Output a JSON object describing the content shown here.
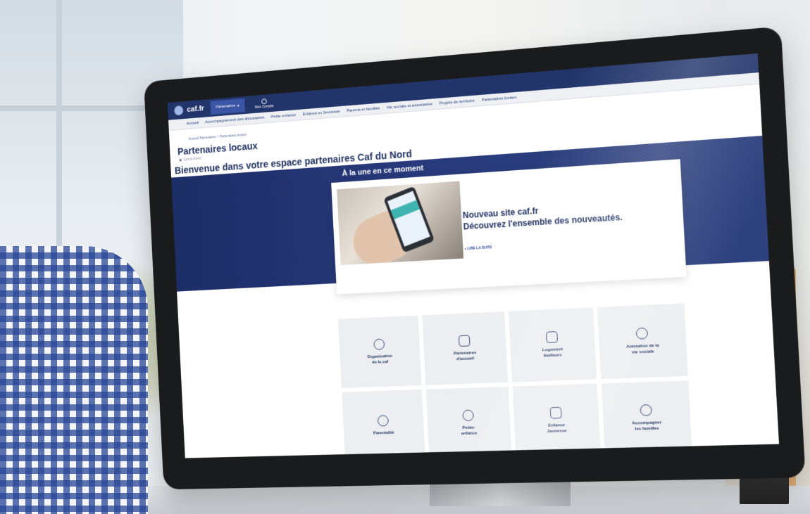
{
  "header": {
    "logo_text": "caf.fr",
    "partner_button": "Partenaires",
    "account_label": "Mon Compte"
  },
  "nav": {
    "items": [
      "Accueil",
      "Accompagnement des allocataires",
      "Petite enfance",
      "Enfance et Jeunesse",
      "Parents et familles",
      "Vie sociale et associative",
      "Projets de territoire",
      "Partenaires locaux"
    ]
  },
  "breadcrumb": "Accueil Partenaires > Partenaires locaux",
  "page": {
    "title": "Partenaires locaux",
    "location": "Caf du Nord",
    "welcome": "Bienvenue dans votre espace partenaires Caf du Nord"
  },
  "hero": {
    "title": "À la une en ce moment",
    "news_headline": "Nouveau site caf.fr",
    "news_sub": "Découvrez l'ensemble des nouveautés.",
    "news_link": "+ LIRE LA SUITE"
  },
  "tiles": [
    {
      "label": "Organisation\nde la caf",
      "icon": "network-icon"
    },
    {
      "label": "Partenaires\nd'accueil",
      "icon": "handshake-icon"
    },
    {
      "label": "Logement\nBailleurs",
      "icon": "house-icon"
    },
    {
      "label": "Animation de la\nvie sociale",
      "icon": "people-icon"
    },
    {
      "label": "Parentalité",
      "icon": "family-icon"
    },
    {
      "label": "Petite-\nenfance",
      "icon": "baby-icon"
    },
    {
      "label": "Enfance\nJeunesse",
      "icon": "child-icon"
    },
    {
      "label": "Accompagner\nles familles",
      "icon": "families-icon"
    }
  ]
}
